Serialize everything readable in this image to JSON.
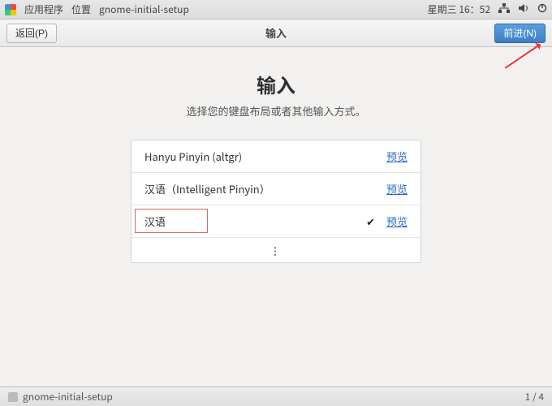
{
  "topbar": {
    "apps": "应用程序",
    "location": "位置",
    "process": "gnome-initial-setup",
    "datetime": "星期三 16：52"
  },
  "header": {
    "back": "返回(P)",
    "title": "输入",
    "forward": "前进(N)"
  },
  "page": {
    "title": "输入",
    "subtitle": "选择您的键盘布局或者其他输入方式。"
  },
  "layouts": [
    {
      "label": "Hanyu Pinyin (altgr)",
      "selected": false,
      "preview": "预览"
    },
    {
      "label": "汉语（Intelligent Pinyin）",
      "selected": false,
      "preview": "预览"
    },
    {
      "label": "汉语",
      "selected": true,
      "preview": "预览"
    }
  ],
  "taskbar": {
    "app": "gnome-initial-setup",
    "workspace": "1 / 4"
  }
}
